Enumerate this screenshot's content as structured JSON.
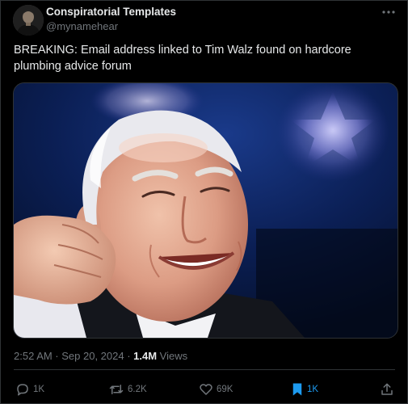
{
  "tweet": {
    "author": {
      "display_name": "Conspiratorial Templates",
      "handle": "@mynamehear"
    },
    "text": "BREAKING: Email address linked to Tim Walz found on hardcore plumbing advice forum",
    "timestamp": "2:52 AM · Sep 20, 2024 · ",
    "views_count": "1.4M",
    "views_label": " Views"
  },
  "actions": {
    "reply": {
      "icon": "reply-icon",
      "count": "1K"
    },
    "retweet": {
      "icon": "retweet-icon",
      "count": "6.2K"
    },
    "like": {
      "icon": "heart-icon",
      "count": "69K"
    },
    "bookmark": {
      "icon": "bookmark-icon",
      "count": "1K",
      "active": true,
      "color": "#1d9bf0"
    },
    "share": {
      "icon": "share-icon"
    }
  },
  "colors": {
    "background": "#000000",
    "text": "#e7e9ea",
    "muted": "#71767b",
    "border": "#2f3336",
    "accent": "#1d9bf0"
  }
}
